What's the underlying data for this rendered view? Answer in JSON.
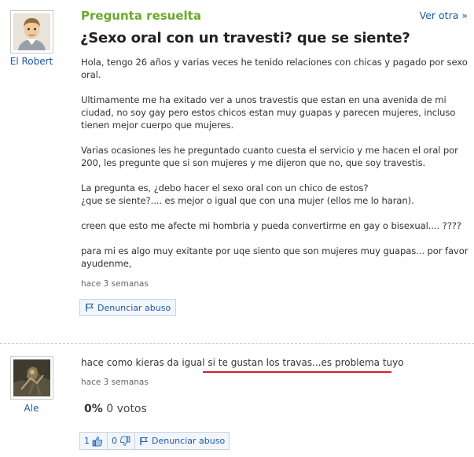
{
  "question": {
    "status": "Pregunta resuelta",
    "more_link": "Ver otra »",
    "title": "¿Sexo oral con un travesti? que se siente?",
    "paragraphs": [
      "Hola, tengo 26 años y varias veces he tenido relaciones con chicas y pagado por sexo oral.",
      "Ultimamente me ha exitado ver a unos travestis que estan en una avenida de mi ciudad, no soy gay pero estos chicos estan muy guapas y parecen mujeres, incluso tienen mejor cuerpo que mujeres.",
      "Varias ocasiones les he preguntado cuanto cuesta el servicio y me hacen el oral por 200, les pregunte que si son mujeres y me dijeron que no, que soy travestis.",
      "La pregunta es, ¿debo hacer el sexo oral con un chico de estos?\n¿que se siente?.... es mejor o igual que con una mujer (ellos me lo haran).",
      "creen que esto me afecte mi hombria y pueda convertirme en gay o bisexual.... ????",
      "para mi es algo muy exitante por uqe siento que son mujeres muy guapas... por favor ayudenme,"
    ],
    "time": "hace 3 semanas",
    "report_label": "Denunciar abuso",
    "author": {
      "name": "El Robert"
    }
  },
  "answer": {
    "text_prefix": "hace como kieras da igual ",
    "text_highlight": "si te gustan los travas...es problema tuyo",
    "time": "hace 3 semanas",
    "rating_percent": "0%",
    "rating_votes": "0 votos",
    "thumbs_up_count": "1",
    "thumbs_down_count": "0",
    "report_label": "Denunciar abuso",
    "author": {
      "name": "Ale"
    }
  },
  "colors": {
    "status_green": "#6aa92c",
    "link_blue": "#1a5aa8",
    "highlight_red": "#d2202a"
  }
}
